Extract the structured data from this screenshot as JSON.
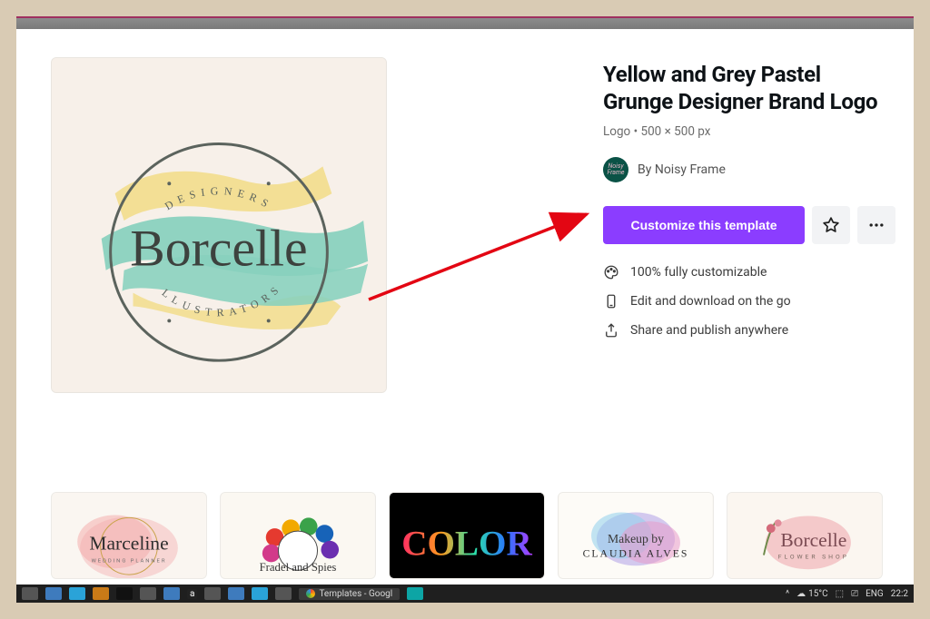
{
  "template": {
    "title": "Yellow and Grey Pastel Grunge Designer Brand Logo",
    "meta": "Logo • 500 × 500 px",
    "by_label": "By ",
    "author": "Noisy Frame",
    "avatar_text": "Noisy Frame",
    "preview": {
      "brand": "Borcelle",
      "top_arc": "DESIGNERS",
      "bottom_arc": "ILLUSTRATORS"
    }
  },
  "actions": {
    "customize": "Customize this template"
  },
  "features": [
    "100% fully customizable",
    "Edit and download on the go",
    "Share and publish anywhere"
  ],
  "thumbs": [
    {
      "name": "Marceline",
      "sub": "WEDDING PLANNER"
    },
    {
      "name": "Fradel and Spies",
      "sub": ""
    },
    {
      "name": "COLOR",
      "sub": ""
    },
    {
      "name": "Makeup by",
      "sub": "CLAUDIA ALVES"
    },
    {
      "name": "Borcelle",
      "sub": "FLOWER SHOP"
    }
  ],
  "taskbar": {
    "tab": "Templates - Googl",
    "temp": "15°C",
    "lang": "ENG",
    "time": "22:2"
  },
  "colors": {
    "primary": "#8b3dff",
    "teal": "#87d0bd",
    "yellow": "#f2dd8c",
    "grey": "#5b635d"
  }
}
